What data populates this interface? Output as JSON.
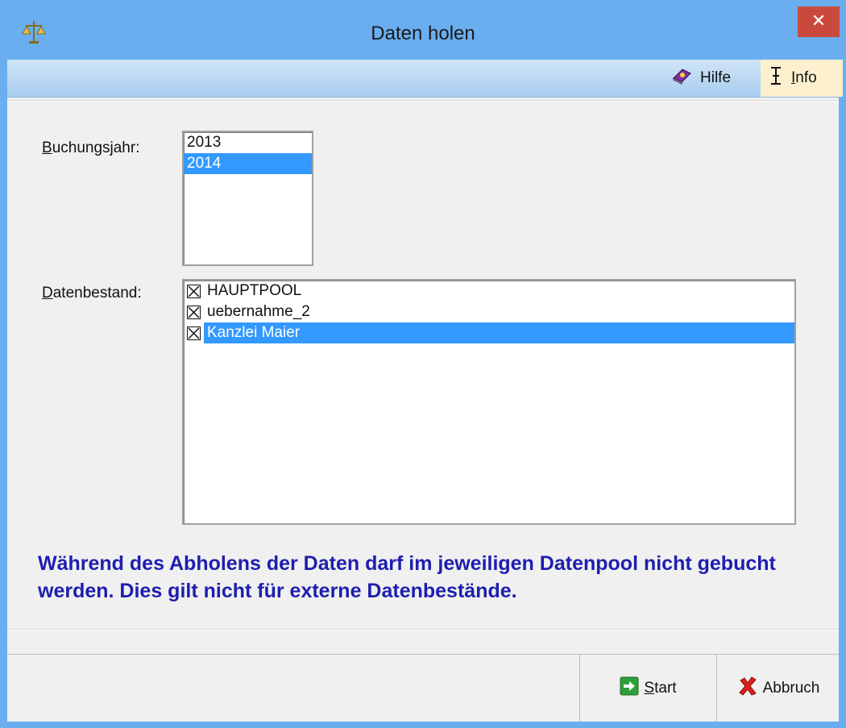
{
  "window": {
    "title": "Daten holen",
    "close_glyph": "✕",
    "app_icon": "scales-icon"
  },
  "menu": {
    "help": {
      "icon": "help-book-icon",
      "accel": "",
      "rest": "Hilfe"
    },
    "info": {
      "icon": "info-cursor-icon",
      "accel": "I",
      "rest": "nfo"
    }
  },
  "form": {
    "year_label": {
      "accel": "B",
      "rest": "uchungsjahr:"
    },
    "years": [
      {
        "label": "2013",
        "selected": false
      },
      {
        "label": "2014",
        "selected": true
      }
    ],
    "dataset_label": {
      "accel": "D",
      "rest": "atenbestand:"
    },
    "datasets": [
      {
        "label": "HAUPTPOOL",
        "checked": true,
        "selected": false
      },
      {
        "label": "uebernahme_2",
        "checked": true,
        "selected": false
      },
      {
        "label": "Kanzlei Maier",
        "checked": true,
        "selected": true
      }
    ],
    "notice": "Während des Abholens der Daten darf im jeweiligen Datenpool nicht gebucht werden. Dies gilt nicht für externe Datenbestände."
  },
  "buttons": {
    "start": {
      "icon": "arrow-right-icon",
      "accel": "S",
      "rest": "tart"
    },
    "abbruch": {
      "icon": "red-x-icon",
      "accel": "",
      "rest": "Abbruch"
    }
  },
  "colors": {
    "titlebar": "#6aaef0",
    "selection": "#3399ff",
    "notice_text": "#1e1eb0",
    "close_button": "#c94a3b"
  }
}
